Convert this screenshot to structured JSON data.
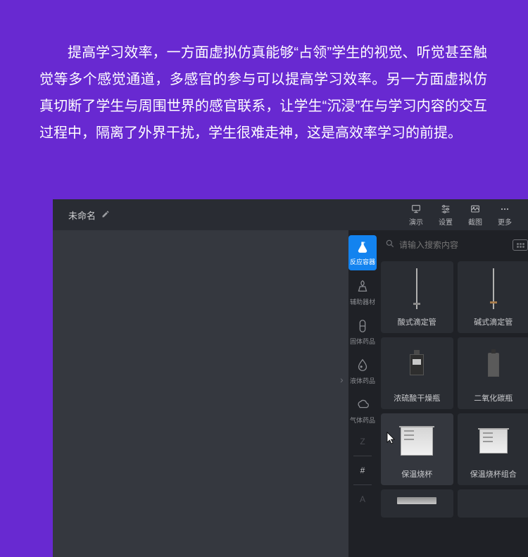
{
  "intro_paragraph": "提高学习效率，一方面虚拟仿真能够“占领”学生的视觉、听觉甚至触觉等多个感觉通道，多感官的参与可以提高学习效率。另一方面虚拟仿真切断了学生与周围世界的感官联系，让学生“沉浸”在与学习内容的交互过程中，隔离了外界干扰，学生很难走神，这是高效率学习的前提。",
  "titlebar": {
    "doc_name": "未命名",
    "buttons": {
      "present": "演示",
      "settings": "设置",
      "screenshot": "截图",
      "more": "更多"
    }
  },
  "side_tabs": {
    "reaction_vessel": "反应容器",
    "auxiliary": "辅助器材",
    "solid": "固体药品",
    "liquid": "液体药品",
    "gas": "气体药品",
    "letter_z": "Z",
    "letter_hash": "#",
    "letter_a": "A"
  },
  "search": {
    "placeholder": "请输入搜索内容"
  },
  "cards": {
    "acid_burette": "酸式滴定管",
    "alkali_burette": "碱式滴定管",
    "h2so4_bottle": "浓硫酸干燥瓶",
    "co2_bottle": "二氧化碳瓶",
    "thermal_beaker": "保温烧杯",
    "thermal_beaker_set": "保温烧杯组合"
  }
}
